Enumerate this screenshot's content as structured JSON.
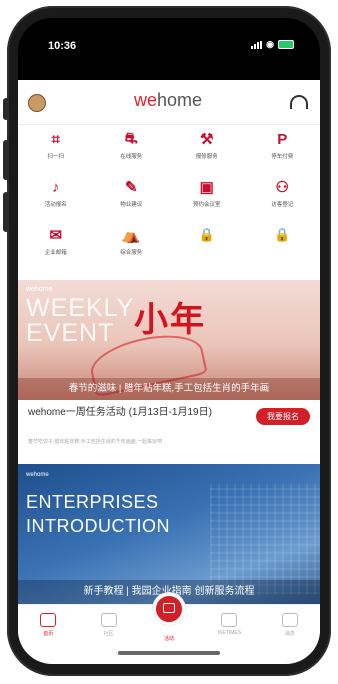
{
  "status": {
    "time": "10:36",
    "wifi": "wifi-icon",
    "battery_color": "#29c96a"
  },
  "header": {
    "logo_prefix": "we",
    "logo_suffix": "home",
    "brand_color": "#e0212b"
  },
  "grid": [
    {
      "icon": "scan-icon",
      "glyph": "⌗",
      "label": "扫一扫"
    },
    {
      "icon": "bank-icon",
      "glyph": "⛐",
      "label": "在线服务"
    },
    {
      "icon": "tools-icon",
      "glyph": "⚒",
      "label": "报修服务"
    },
    {
      "icon": "parking-icon",
      "glyph": "P",
      "label": "停车付费"
    },
    {
      "icon": "music-icon",
      "glyph": "♪",
      "label": "活动报名"
    },
    {
      "icon": "edit-icon",
      "glyph": "✎",
      "label": "物业建议"
    },
    {
      "icon": "booking-icon",
      "glyph": "▣",
      "label": "预约会议室"
    },
    {
      "icon": "visitor-icon",
      "glyph": "⚇",
      "label": "访客登记"
    },
    {
      "icon": "mail-icon",
      "glyph": "✉",
      "label": "企业邮箱"
    },
    {
      "icon": "shop-icon",
      "glyph": "⛺",
      "label": "综合服务"
    },
    {
      "icon": "lock-icon",
      "glyph": "🔒",
      "label": "",
      "locked": true
    },
    {
      "icon": "lock-icon",
      "glyph": "🔒",
      "label": "",
      "locked": true
    }
  ],
  "banner1": {
    "brand": "wehome",
    "title": "WEEKLY EVENT",
    "title_cn": "小年",
    "caption": "春节的滋味 | 腊年贴年糕,手工包括生肖的手年画"
  },
  "event": {
    "title": "wehome一周任务活动 (1月13日-1月19日)",
    "subtitle": "春节吃饺子,腊年贴年糕,手工包括生肖的千年画面,一起来玩吧",
    "button": "我要报名"
  },
  "banner2": {
    "brand": "wehome",
    "title_line1": "ENTERPRISES",
    "title_line2": "INTRODUCTION",
    "caption": "新手教程 | 我园企业指南 创新服务流程"
  },
  "tabs": [
    {
      "label": "首页",
      "icon": "home-icon",
      "active": true
    },
    {
      "label": "社区",
      "icon": "grid-icon"
    },
    {
      "label": "活动",
      "icon": "wallet-icon",
      "center": true
    },
    {
      "label": "WETIMES",
      "icon": "wetimes-icon"
    },
    {
      "label": "消息",
      "icon": "bell-icon"
    }
  ]
}
